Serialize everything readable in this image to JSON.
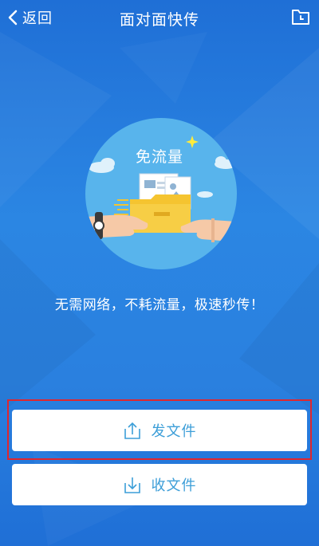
{
  "header": {
    "back_label": "返回",
    "title": "面对面快传",
    "history_icon": "clock-folder-icon"
  },
  "hero": {
    "badge_text": "免流量",
    "illustration": "hands-passing-folder-illustration"
  },
  "tagline": "无需网络，不耗流量，极速秒传！",
  "actions": {
    "send_label": "发文件",
    "send_icon": "upload-icon",
    "receive_label": "收文件",
    "receive_icon": "download-icon"
  },
  "colors": {
    "background": "#2a80df",
    "accent_text": "#3c9ed8",
    "highlight": "#e0262e",
    "folder": "#f5c430"
  }
}
